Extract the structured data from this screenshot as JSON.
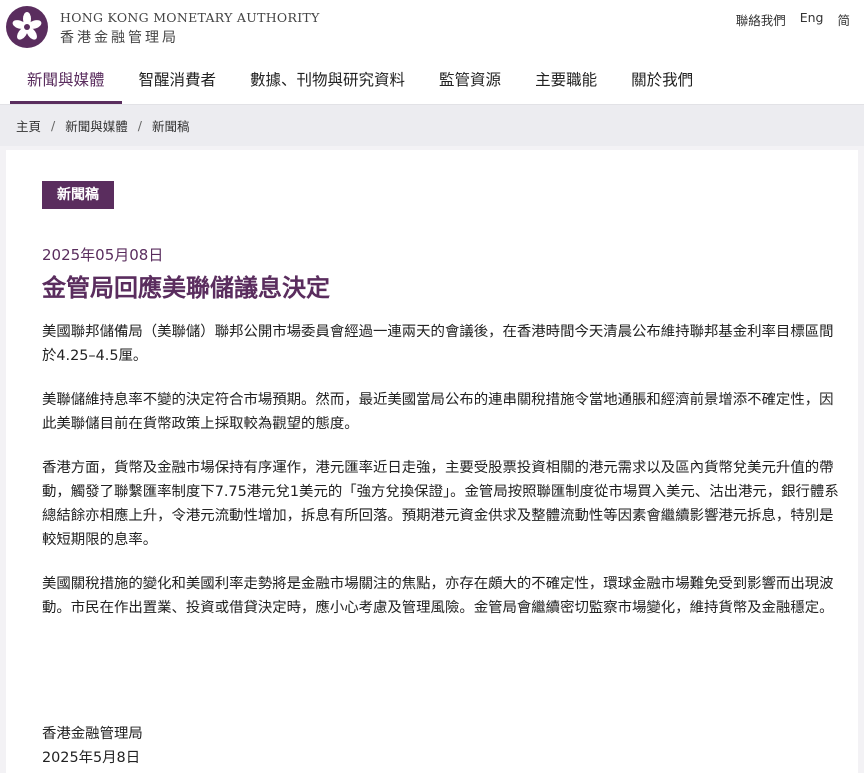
{
  "header": {
    "brand_en": "HONG KONG MONETARY AUTHORITY",
    "brand_zh": "香港金融管理局",
    "utility": {
      "contact": "聯絡我們",
      "english": "Eng",
      "simplified": "简"
    }
  },
  "nav": {
    "items": [
      {
        "label": "新聞與媒體",
        "active": true
      },
      {
        "label": "智醒消費者",
        "active": false
      },
      {
        "label": "數據、刊物與研究資料",
        "active": false
      },
      {
        "label": "監管資源",
        "active": false
      },
      {
        "label": "主要職能",
        "active": false
      },
      {
        "label": "關於我們",
        "active": false
      }
    ]
  },
  "breadcrumb": {
    "items": [
      "主頁",
      "新聞與媒體",
      "新聞稿"
    ]
  },
  "article": {
    "badge": "新聞稿",
    "date": "2025年05月08日",
    "title": "金管局回應美聯儲議息決定",
    "paragraphs": [
      "美國聯邦儲備局（美聯儲）聯邦公開市場委員會經過一連兩天的會議後，在香港時間今天清晨公布維持聯邦基金利率目標區間於4.25–4.5厘。",
      "美聯儲維持息率不變的決定符合市場預期。然而，最近美國當局公布的連串關稅措施令當地通脹和經濟前景增添不確定性，因此美聯儲目前在貨幣政策上採取較為觀望的態度。",
      "香港方面，貨幣及金融市場保持有序運作，港元匯率近日走強，主要受股票投資相關的港元需求以及區內貨幣兌美元升值的帶動，觸發了聯繫匯率制度下7.75港元兌1美元的「強方兌換保證」。金管局按照聯匯制度從市場買入美元、沽出港元，銀行體系總結餘亦相應上升，令港元流動性增加，拆息有所回落。預期港元資金供求及整體流動性等因素會繼續影響港元拆息，特別是較短期限的息率。",
      "美國關稅措施的變化和美國利率走勢將是金融市場關注的焦點，亦存在頗大的不確定性，環球金融市場難免受到影響而出現波動。市民在作出置業、投資或借貸決定時，應小心考慮及管理風險。金管局會繼續密切監察市場變化，維持貨幣及金融穩定。"
    ],
    "signoff_org": "香港金融管理局",
    "signoff_date": "2025年5月8日"
  },
  "colors": {
    "brand": "#5a2d5e",
    "breadcrumb_bg": "#ececf0"
  }
}
